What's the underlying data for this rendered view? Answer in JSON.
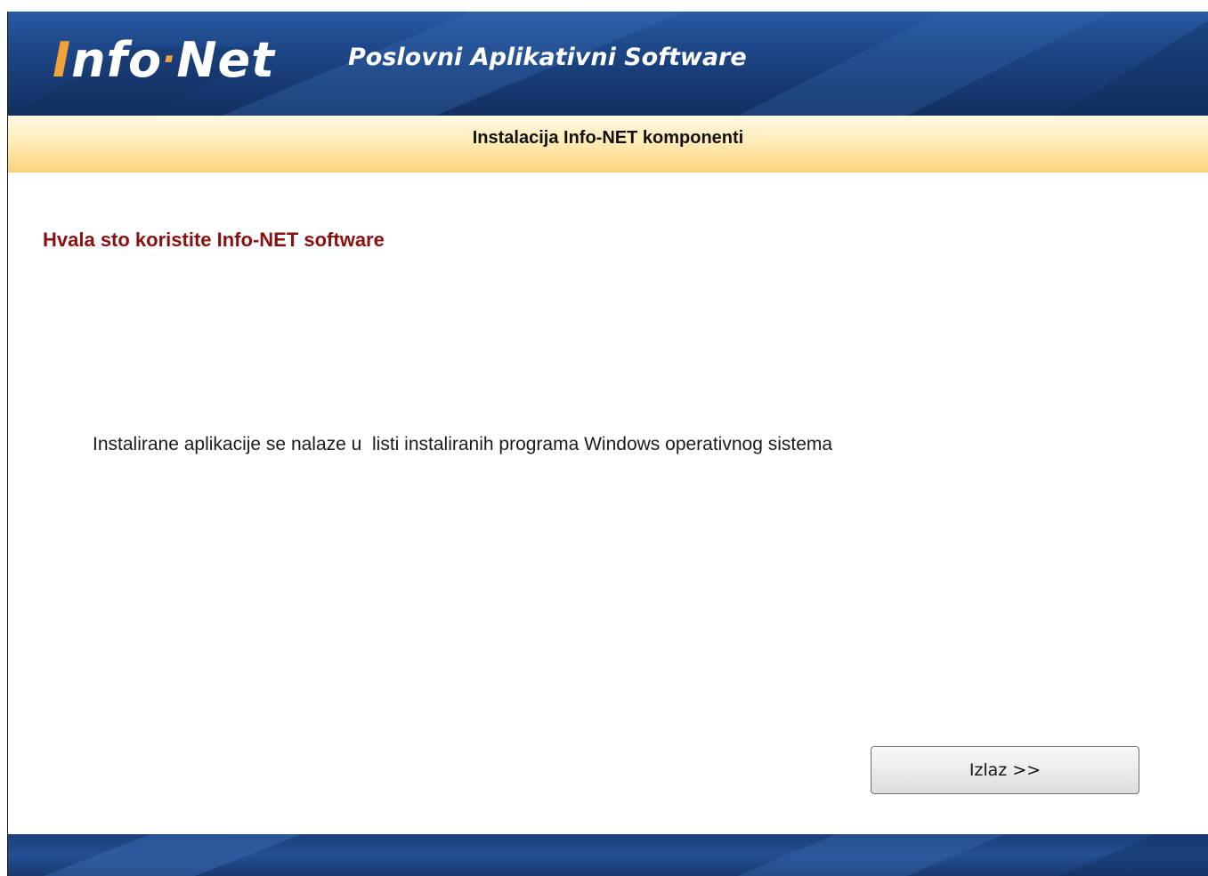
{
  "header": {
    "logo": {
      "initial": "I",
      "part1": "nfo",
      "dot": "·",
      "part2": "Net"
    },
    "tagline": "Poslovni  Aplikativni Software"
  },
  "title_band": {
    "text": "Instalacija Info-NET komponenti"
  },
  "main": {
    "heading": "Hvala sto koristite Info-NET software",
    "info": "Instalirane aplikacije se nalaze u  listi instaliranih programa Windows operativnog sistema"
  },
  "actions": {
    "exit_label": "Izlaz >>"
  },
  "colors": {
    "header_blue": "#1d4787",
    "logo_orange": "#f2a23a",
    "band_gold": "#fbd27a",
    "heading_red": "#8a1010"
  }
}
